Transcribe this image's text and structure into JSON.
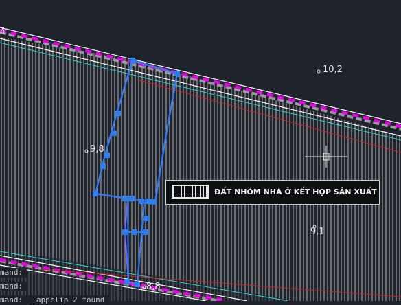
{
  "drawing": {
    "parcel_label": "ĐẤT NHÓM NHÀ Ở KẾT HỢP SẢN XUẤT",
    "elevations": [
      {
        "id": "e1",
        "text": "10,2"
      },
      {
        "id": "e2",
        "text": "9,8"
      },
      {
        "id": "e3",
        "text": "9,1"
      },
      {
        "id": "e4",
        "text": "8,8"
      }
    ],
    "top_left_fragment": "4",
    "colors": {
      "background": "#1f232c",
      "hatch": "#d9d9d9",
      "boundary_magenta": "#e400e4",
      "road_line": "#ffffff",
      "cyan_line": "#31d6d6",
      "red_line": "#d02020",
      "selection_blue": "#2c7df0",
      "polyline_purple": "#7a5cff"
    }
  },
  "command_line": {
    "lines": [
      "mand:",
      "mand:",
      "mand:  _appclip 2 found"
    ]
  }
}
